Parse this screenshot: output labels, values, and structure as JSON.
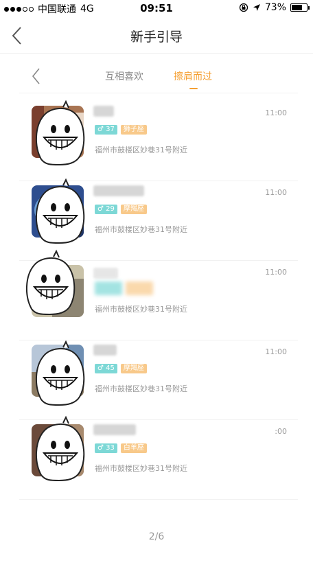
{
  "status_bar": {
    "carrier": "中国联通",
    "network": "4G",
    "time": "09:51",
    "battery": "73%",
    "battery_level": 0.73
  },
  "nav": {
    "title": "新手引导"
  },
  "tabs": [
    {
      "label": "互相喜欢",
      "active": false
    },
    {
      "label": "擦肩而过",
      "active": true
    }
  ],
  "items": [
    {
      "age": "♂ 37",
      "zodiac": "狮子座",
      "location": "福州市鼓楼区妙巷31号附近",
      "time": "11:00"
    },
    {
      "age": "♂ 29",
      "zodiac": "摩羯座",
      "location": "福州市鼓楼区妙巷31号附近",
      "time": "11:00"
    },
    {
      "age": "",
      "zodiac": "",
      "location": "福州市鼓楼区妙巷31号附近",
      "time": "11:00"
    },
    {
      "age": "♂ 45",
      "zodiac": "摩羯座",
      "location": "福州市鼓楼区妙巷31号附近",
      "time": "11:00"
    },
    {
      "age": "♂ 33",
      "zodiac": "白羊座",
      "location": "福州市鼓楼区妙巷31号附近",
      "time": ":00"
    }
  ],
  "pager": "2/6",
  "colors": {
    "accent": "#f5a033",
    "gender_badge": "#7dd8d6",
    "zodiac_badge": "#f8c98a"
  }
}
